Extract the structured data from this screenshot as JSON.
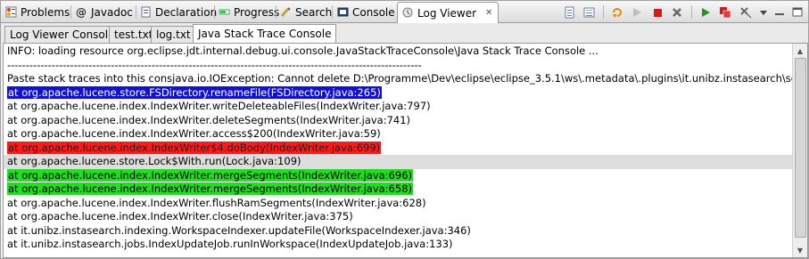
{
  "view_tabs": [
    {
      "label": "Problems",
      "icon": "problems-icon"
    },
    {
      "label": "Javadoc",
      "icon": "javadoc-icon"
    },
    {
      "label": "Declaration",
      "icon": "declaration-icon"
    },
    {
      "label": "Progress",
      "icon": "progress-icon"
    },
    {
      "label": "Search",
      "icon": "search-icon"
    },
    {
      "label": "Console",
      "icon": "console-icon"
    },
    {
      "label": "Log Viewer",
      "icon": "log-viewer-icon"
    }
  ],
  "active_view_tab": "Log Viewer",
  "close_glyph": "✕",
  "toolbar_icons": [
    "document-icon",
    "list-icon",
    "refresh-icon",
    "run-icon",
    "stop-icon",
    "remove-icon",
    "play-icon",
    "terminate-all-icon",
    "settings-icon",
    "minimize-icon",
    "maximize-icon"
  ],
  "console_tabs": [
    "Log Viewer Console",
    "test.txt",
    "log.txt",
    "Java Stack Trace Console"
  ],
  "active_console_tab": "Java Stack Trace Console",
  "lines": [
    {
      "text": "INFO: loading resource org.eclipse.jdt.internal.debug.ui.console.JavaStackTraceConsole\\Java Stack Trace Console ...",
      "highlight": "none"
    },
    {
      "text": "----------------------------------------------------------------------------------------------------------------",
      "highlight": "none"
    },
    {
      "text": "Paste stack traces into this consjava.io.IOException: Cannot delete D:\\Programme\\Dev\\eclipse\\eclipse_3.5.1\\ws\\.metadata\\.plugins\\it.unibz.instasearch\\searchindex\\de",
      "highlight": "none"
    },
    {
      "text": "at org.apache.lucene.store.FSDirectory.renameFile(FSDirectory.java:265)",
      "highlight": "blue"
    },
    {
      "text": "at org.apache.lucene.index.IndexWriter.writeDeleteableFiles(IndexWriter.java:797)",
      "highlight": "none"
    },
    {
      "text": "at org.apache.lucene.index.IndexWriter.deleteSegments(IndexWriter.java:741)",
      "highlight": "none"
    },
    {
      "text": "at org.apache.lucene.index.IndexWriter.access$200(IndexWriter.java:59)",
      "highlight": "none"
    },
    {
      "text": "at org.apache.lucene.index.IndexWriter$4.doBody(IndexWriter.java:699)",
      "highlight": "red"
    },
    {
      "text": "at org.apache.lucene.store.Lock$With.run(Lock.java:109)",
      "highlight": "selected"
    },
    {
      "text": "at org.apache.lucene.index.IndexWriter.mergeSegments(IndexWriter.java:696)",
      "highlight": "green"
    },
    {
      "text": "at org.apache.lucene.index.IndexWriter.mergeSegments(IndexWriter.java:658)",
      "highlight": "green"
    },
    {
      "text": "at org.apache.lucene.index.IndexWriter.flushRamSegments(IndexWriter.java:628)",
      "highlight": "none"
    },
    {
      "text": "at org.apache.lucene.index.IndexWriter.close(IndexWriter.java:375)",
      "highlight": "none"
    },
    {
      "text": "at it.unibz.instasearch.indexing.WorkspaceIndexer.updateFile(WorkspaceIndexer.java:346)",
      "highlight": "none"
    },
    {
      "text": "at it.unibz.instasearch.jobs.IndexUpdateJob.runInWorkspace(IndexUpdateJob.java:133)",
      "highlight": "none"
    }
  ],
  "colors": {
    "highlight_blue": "#1010d8",
    "highlight_red": "#ff1a1a",
    "highlight_green": "#22dd22",
    "selected_line": "#dedede"
  }
}
